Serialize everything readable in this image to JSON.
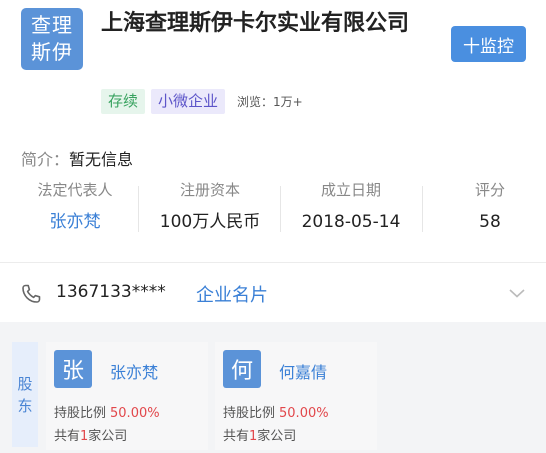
{
  "header": {
    "logo_line1": "查理",
    "logo_line2": "斯伊",
    "company_name": "上海查理斯伊卡尔实业有限公司",
    "monitor_button": "十监控",
    "tags": [
      "存续",
      "小微企业"
    ],
    "views_label": "浏览：",
    "views_value": "1万+"
  },
  "intro": {
    "label": "简介：",
    "value": "暂无信息"
  },
  "info": {
    "legal_rep_title": "法定代表人",
    "legal_rep_value": "张亦梵",
    "capital_title": "注册资本",
    "capital_value": "100万人民币",
    "founded_title": "成立日期",
    "founded_value": "2018-05-14",
    "score_title": "评分",
    "score_value": "58"
  },
  "contact": {
    "phone": "1367133****",
    "card_link": "企业名片"
  },
  "shareholders": {
    "tab_char1": "股",
    "tab_char2": "东",
    "items": [
      {
        "avatar": "张",
        "name": "张亦梵",
        "ratio_label": "持股比例",
        "ratio_value": "50.00%",
        "count_prefix": "共有",
        "count_value": "1",
        "count_suffix": "家公司"
      },
      {
        "avatar": "何",
        "name": "何嘉倩",
        "ratio_label": "持股比例",
        "ratio_value": "50.00%",
        "count_prefix": "共有",
        "count_value": "1",
        "count_suffix": "家公司"
      }
    ]
  },
  "colors": {
    "brand_blue": "#5b93d8",
    "link_blue": "#3b80d6",
    "tag_green": "#39a360",
    "tag_purple": "#5d55c9",
    "highlight_red": "#e2474b"
  },
  "icons": [
    "phone-icon",
    "chevron-down-icon"
  ]
}
